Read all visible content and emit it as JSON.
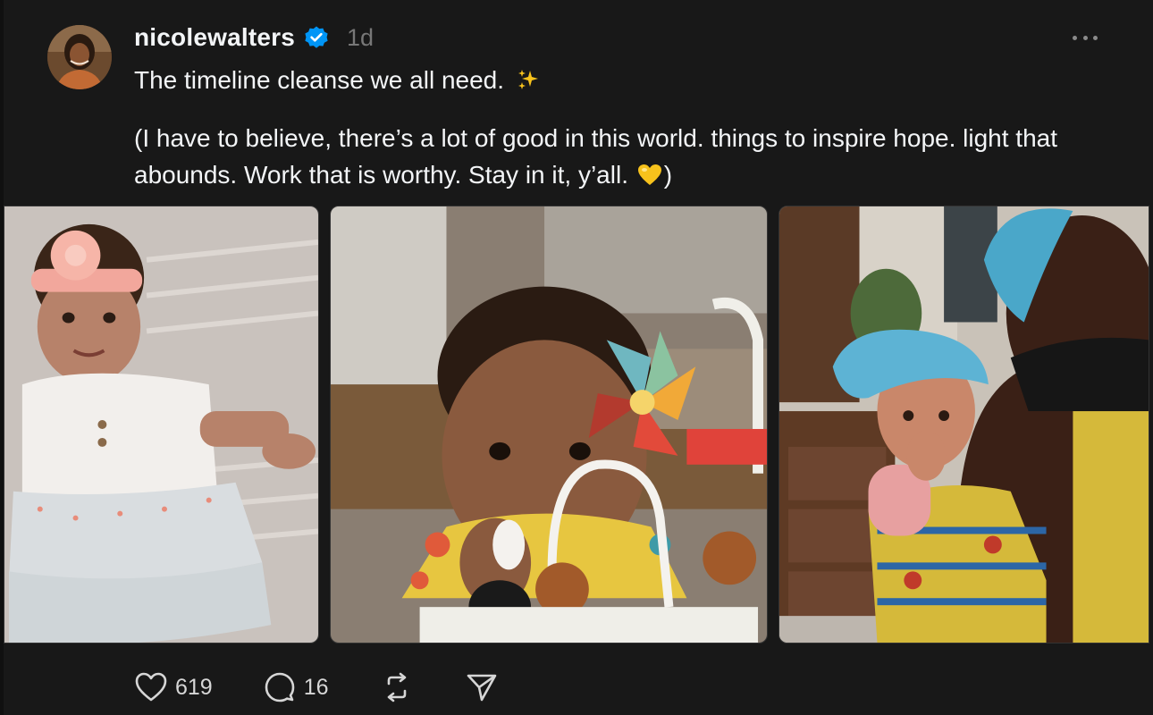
{
  "post": {
    "username": "nicolewalters",
    "verified": true,
    "time": "1d",
    "text_line1": "The timeline cleanse we all need.",
    "text_line1_emoji": "sparkles",
    "text_body": "(I have to believe, there’s a lot of good in this world. things to inspire hope. light that abounds. Work that is worthy. Stay in it, y’all.",
    "text_body_emoji": "yellow-heart",
    "text_body_close": ")",
    "images": [
      {
        "subject": "baby-with-pink-headband"
      },
      {
        "subject": "baby-with-toy"
      },
      {
        "subject": "woman-carrying-baby"
      }
    ]
  },
  "actions": {
    "likes": "619",
    "replies": "16"
  },
  "colors": {
    "background": "#181818",
    "text": "#f3f5f7",
    "muted": "#777777",
    "verified": "#0095f6",
    "emoji_heart": "#f7c21c"
  },
  "icons": {
    "like": "heart-icon",
    "reply": "comment-icon",
    "repost": "repost-icon",
    "share": "send-icon",
    "more": "more-icon"
  }
}
